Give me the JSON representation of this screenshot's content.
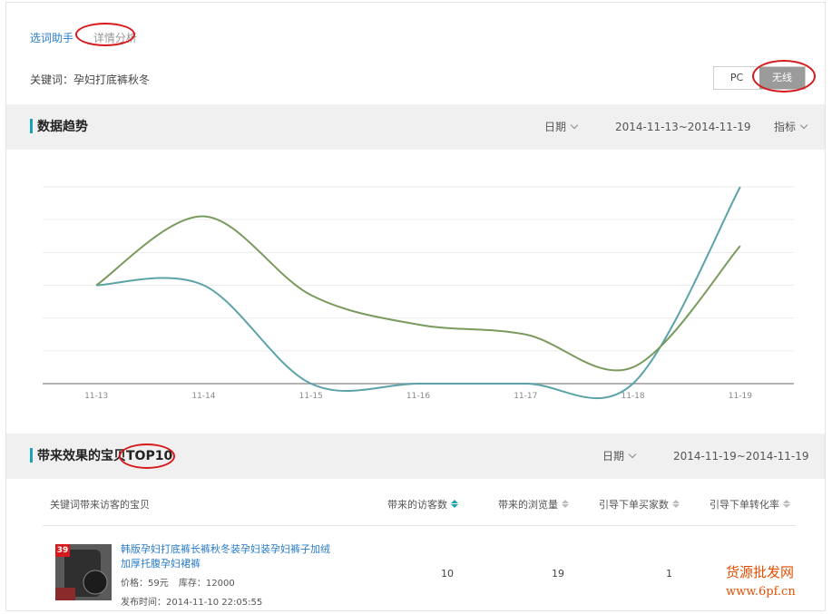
{
  "breadcrumb": {
    "home": "选词助手",
    "current": "详情分析"
  },
  "keyword": {
    "label": "关键词：",
    "value": "孕妇打底裤秋冬"
  },
  "device": {
    "pc": "PC",
    "wireless": "无线",
    "active": "wireless"
  },
  "trend": {
    "title": "数据趋势",
    "date_label": "日期",
    "date_range": "2014-11-13~2014-11-19",
    "metric_label": "指标"
  },
  "chart_data": {
    "type": "line",
    "x": [
      "11-13",
      "11-14",
      "11-15",
      "11-16",
      "11-17",
      "11-18",
      "11-19"
    ],
    "ylim": [
      0,
      6
    ],
    "grid": true,
    "series": [
      {
        "color": "#5ba3a8",
        "values": [
          3,
          3,
          0,
          0,
          0,
          0,
          6
        ]
      },
      {
        "color": "#7a9b5e",
        "values": [
          3,
          5.1,
          2.7,
          1.8,
          1.5,
          0.5,
          4.2
        ]
      }
    ]
  },
  "top10": {
    "title_prefix": "带来效果的宝贝",
    "title_suffix": "TOP10",
    "date_label": "日期",
    "date_range": "2014-11-19~2014-11-19",
    "columns": [
      "关键词带来访客的宝贝",
      "带来的访客数",
      "带来的浏览量",
      "引导下单买家数",
      "引导下单转化率"
    ],
    "rows": [
      {
        "badge": "39",
        "title": "韩版孕妇打底裤长裤秋冬装孕妇装孕妇裤子加绒加厚托腹孕妇裙裤",
        "price_label": "价格：",
        "price": "59元",
        "stock_label": "库存：",
        "stock": "12000",
        "publish_label": "发布时间：",
        "publish_time": "2014-11-10 22:05:55",
        "visitors": "10",
        "pageviews": "19",
        "buyers": "1"
      }
    ]
  },
  "watermark": {
    "name": "货源批发网",
    "url": "www.6pf.cn"
  }
}
